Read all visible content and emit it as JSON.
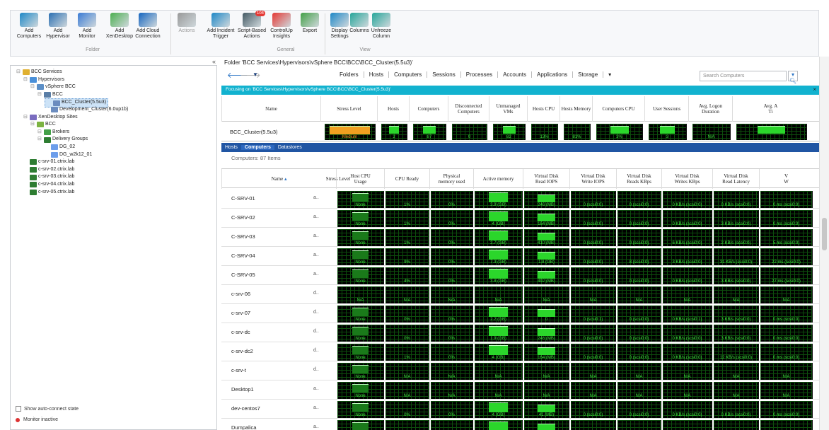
{
  "ribbon": {
    "buttons": [
      {
        "label": "Add\nComputers",
        "icon": "add-computers-icon"
      },
      {
        "label": "Add\nHypervisor",
        "icon": "add-hypervisor-icon"
      },
      {
        "label": "Add\nMonitor",
        "icon": "add-monitor-icon"
      },
      {
        "label": "Add\nXenDesktop",
        "icon": "add-xendesktop-icon"
      },
      {
        "label": "Add Cloud\nConnection",
        "icon": "cloud-icon"
      },
      {
        "label": "Actions",
        "icon": "actions-icon"
      },
      {
        "label": "Add Incident\nTrigger",
        "icon": "incident-trigger-icon"
      },
      {
        "label": "Script-Based\nActions",
        "icon": "script-icon",
        "badge": "104"
      },
      {
        "label": "ControlUp\nInsights",
        "icon": "insights-icon"
      },
      {
        "label": "Export",
        "icon": "export-icon"
      },
      {
        "label": "Display\nSettings",
        "icon": "display-settings-icon"
      },
      {
        "label": "Columns",
        "icon": "columns-icon"
      },
      {
        "label": "Unfreeze\nColumn",
        "icon": "unfreeze-icon"
      }
    ],
    "groups": [
      "Folder",
      "General",
      "View"
    ]
  },
  "path": "Folder 'BCC Services\\Hypervisors\\vSphere BCC\\BCC\\BCC_Cluster(5.5u3)'",
  "tree": [
    {
      "label": "BCC Services",
      "indent": 0,
      "icon": "folder-icon"
    },
    {
      "label": "Hypervisors",
      "indent": 1,
      "icon": "hypervisors-icon"
    },
    {
      "label": "vSphere BCC",
      "indent": 2,
      "icon": "vsphere-icon"
    },
    {
      "label": "BCC",
      "indent": 3,
      "icon": "datacenter-icon"
    },
    {
      "label": "BCC_Cluster(5.5u3)",
      "indent": 4,
      "icon": "cluster-icon",
      "selected": true
    },
    {
      "label": "Development_Cluster(6.0up1b)",
      "indent": 4,
      "icon": "cluster-icon"
    },
    {
      "label": "XenDesktop Sites",
      "indent": 1,
      "icon": "xendesktop-icon"
    },
    {
      "label": "BCC",
      "indent": 2,
      "icon": "site-icon"
    },
    {
      "label": "Brokers",
      "indent": 3,
      "icon": "brokers-icon"
    },
    {
      "label": "Delivery Groups",
      "indent": 3,
      "icon": "delivery-groups-icon"
    },
    {
      "label": "DG_02",
      "indent": 4,
      "icon": "group-icon"
    },
    {
      "label": "DG_w2k12_01",
      "indent": 4,
      "icon": "group-icon"
    },
    {
      "label": "c-srv-01.ctrix.lab",
      "indent": 1,
      "icon": "server-icon"
    },
    {
      "label": "c-srv-02.ctrix.lab",
      "indent": 1,
      "icon": "server-icon"
    },
    {
      "label": "c-srv-03.ctrix.lab",
      "indent": 1,
      "icon": "server-icon"
    },
    {
      "label": "c-srv-04.ctrix.lab",
      "indent": 1,
      "icon": "server-icon"
    },
    {
      "label": "c-srv-05.ctrix.lab",
      "indent": 1,
      "icon": "server-icon"
    }
  ],
  "footer": {
    "auto_connect": "Show auto-connect state",
    "monitor": "Monitor inactive"
  },
  "nav_tabs": [
    "Folders",
    "Hosts",
    "Computers",
    "Sessions",
    "Processes",
    "Accounts",
    "Applications",
    "Storage"
  ],
  "search_placeholder": "Search Computers",
  "focus_text": "Focusing on 'BCC Services\\Hypervisors\\vSphere BCC\\BCC\\BCC_Cluster(5.5u3)'",
  "cluster": {
    "headers": [
      "Name",
      "Stress Level",
      "Hosts",
      "Computers",
      "Disconnected\nComputers",
      "Unmanaged\nVMs",
      "Hosts CPU",
      "Hosts Memory",
      "Computers CPU",
      "User Sessions",
      "Avg. Logon\nDuration",
      "Avg. A\nTi"
    ],
    "name": "BCC_Cluster(5.5u3)",
    "values": [
      "Medium",
      "2",
      "87",
      "0",
      "82",
      "13%",
      "81%",
      "3%",
      "3",
      "N/A",
      ""
    ]
  },
  "sub_tabs": [
    "Hosts",
    "Computers",
    "Datastores"
  ],
  "count": "Computers: 87 Items",
  "grid": {
    "headers": [
      "Name",
      "Stress Level",
      "Host CPU\nUsage",
      "CPU Ready",
      "Physical\nmemory used",
      "Active memory",
      "Virtual Disk\nRead IOPS",
      "Virtual Disk\nWrite IOPS",
      "Virtual Disk\nReads KBps",
      "Virtual Disk\nWrites KBps",
      "Virtual Disk\nRead Latency",
      "V\nW"
    ],
    "rows": [
      {
        "name": "C-SRV-01",
        "t": "a..",
        "v": [
          "None",
          "1%",
          "0%",
          "3.9 (GB)",
          "246 (MB)",
          "0 (scsi0:0)",
          "0 (scsi0:0)",
          "0 KB/s (scsi0:0)",
          "0 KB/s (scsi0:0)",
          "0 ms (scsi0:0)"
        ]
      },
      {
        "name": "C-SRV-02",
        "t": "a..",
        "v": [
          "None",
          "1%",
          "0%",
          "4 (GB)",
          "164 (MB)",
          "0 (scsi0:0)",
          "0 (scsi0:0)",
          "0 KB/s (scsi0:0)",
          "3 KB/s (scsi0:0)",
          "0 ms (scsi0:0)"
        ]
      },
      {
        "name": "C-SRV-03",
        "t": "a..",
        "v": [
          "None",
          "1%",
          "0%",
          "2.7 (GB)",
          "410 (MB)",
          "0 (scsi0:0)",
          "0 (scsi0:0)",
          "6 KB/s (scsi0:0)",
          "2 KB/s (scsi0:0)",
          "5 ms (scsi0:0)"
        ]
      },
      {
        "name": "C-SRV-04",
        "t": "a..",
        "v": [
          "None",
          "9%",
          "0%",
          "7.3 (GB)",
          "1.8 (GB)",
          "0 (scsi0:0)",
          "8 (scsi0:0)",
          "3 KB/s (scsi0:0)",
          "31 KB/s (scsi0:0)",
          "22 ms (scsi0:0)"
        ]
      },
      {
        "name": "C-SRV-05",
        "t": "a..",
        "v": [
          "None",
          "4%",
          "0%",
          "3.8 (GB)",
          "492 (MB)",
          "0 (scsi0:0)",
          "0 (scsi0:0)",
          "0 KB/s (scsi0:0)",
          "3 KB/s (scsi0:0)",
          "27 ms (scsi0:0)"
        ]
      },
      {
        "name": "c-srv-06",
        "t": "d..",
        "v": [
          "N/A",
          "N/A",
          "N/A",
          "N/A",
          "N/A",
          "N/A",
          "N/A",
          "N/A",
          "N/A",
          "N/A"
        ]
      },
      {
        "name": "c-srv-07",
        "t": "d..",
        "v": [
          "None",
          "0%",
          "0%",
          "2.2 (GB)",
          "0",
          "0 (scsi0:1)",
          "0 (scsi0:0)",
          "0 KB/s (scsi0:1)",
          "3 KB/s (scsi0:0)",
          "0 ms (scsi0:0)"
        ]
      },
      {
        "name": "c-srv-dc",
        "t": "d..",
        "v": [
          "None",
          "0%",
          "0%",
          "1.9 (GB)",
          "246 (MB)",
          "0 (scsi0:0)",
          "0 (scsi0:0)",
          "0 KB/s (scsi0:0)",
          "3 KB/s (scsi0:0)",
          "0 ms (scsi0:0)"
        ]
      },
      {
        "name": "c-srv-dc2",
        "t": "d..",
        "v": [
          "None",
          "1%",
          "0%",
          "4 (GB)",
          "164 (MB)",
          "0 (scsi0:0)",
          "0 (scsi0:0)",
          "0 KB/s (scsi0:0)",
          "12 KB/s (scsi0:0)",
          "0 ms (scsi0:0)"
        ]
      },
      {
        "name": "c-srv-t",
        "t": "d..",
        "v": [
          "None",
          "N/A",
          "N/A",
          "N/A",
          "N/A",
          "N/A",
          "N/A",
          "N/A",
          "N/A",
          "N/A"
        ]
      },
      {
        "name": "Desktop1",
        "t": "a..",
        "v": [
          "None",
          "N/A",
          "N/A",
          "N/A",
          "N/A",
          "N/A",
          "N/A",
          "N/A",
          "N/A",
          "N/A"
        ]
      },
      {
        "name": "dev-centos7",
        "t": "a..",
        "v": [
          "None",
          "0%",
          "0%",
          "4 (GB)",
          "41 (MB)",
          "0 (scsi0:0)",
          "0 (scsi0:0)",
          "0 KB/s (scsi0:0)",
          "0 KB/s (scsi0:0)",
          "0 ms (scsi0:0)"
        ]
      },
      {
        "name": "Dumpalica",
        "t": "a..",
        "v": [
          "None",
          "3%",
          "1%",
          "4 (GB)",
          "82 (MB)",
          "0 (scsi0:1)",
          "2 (scsi0:0)",
          "0 KB/s (scsi0:0)",
          "2 KB/s (scsi0:0)",
          "0 ms (scsi0:0)"
        ]
      }
    ]
  },
  "colors": {
    "accent": "#12b2cf",
    "subtab": "#2055a3",
    "graph_green": "#2bd62b",
    "stress_medium": "#f0a020"
  }
}
